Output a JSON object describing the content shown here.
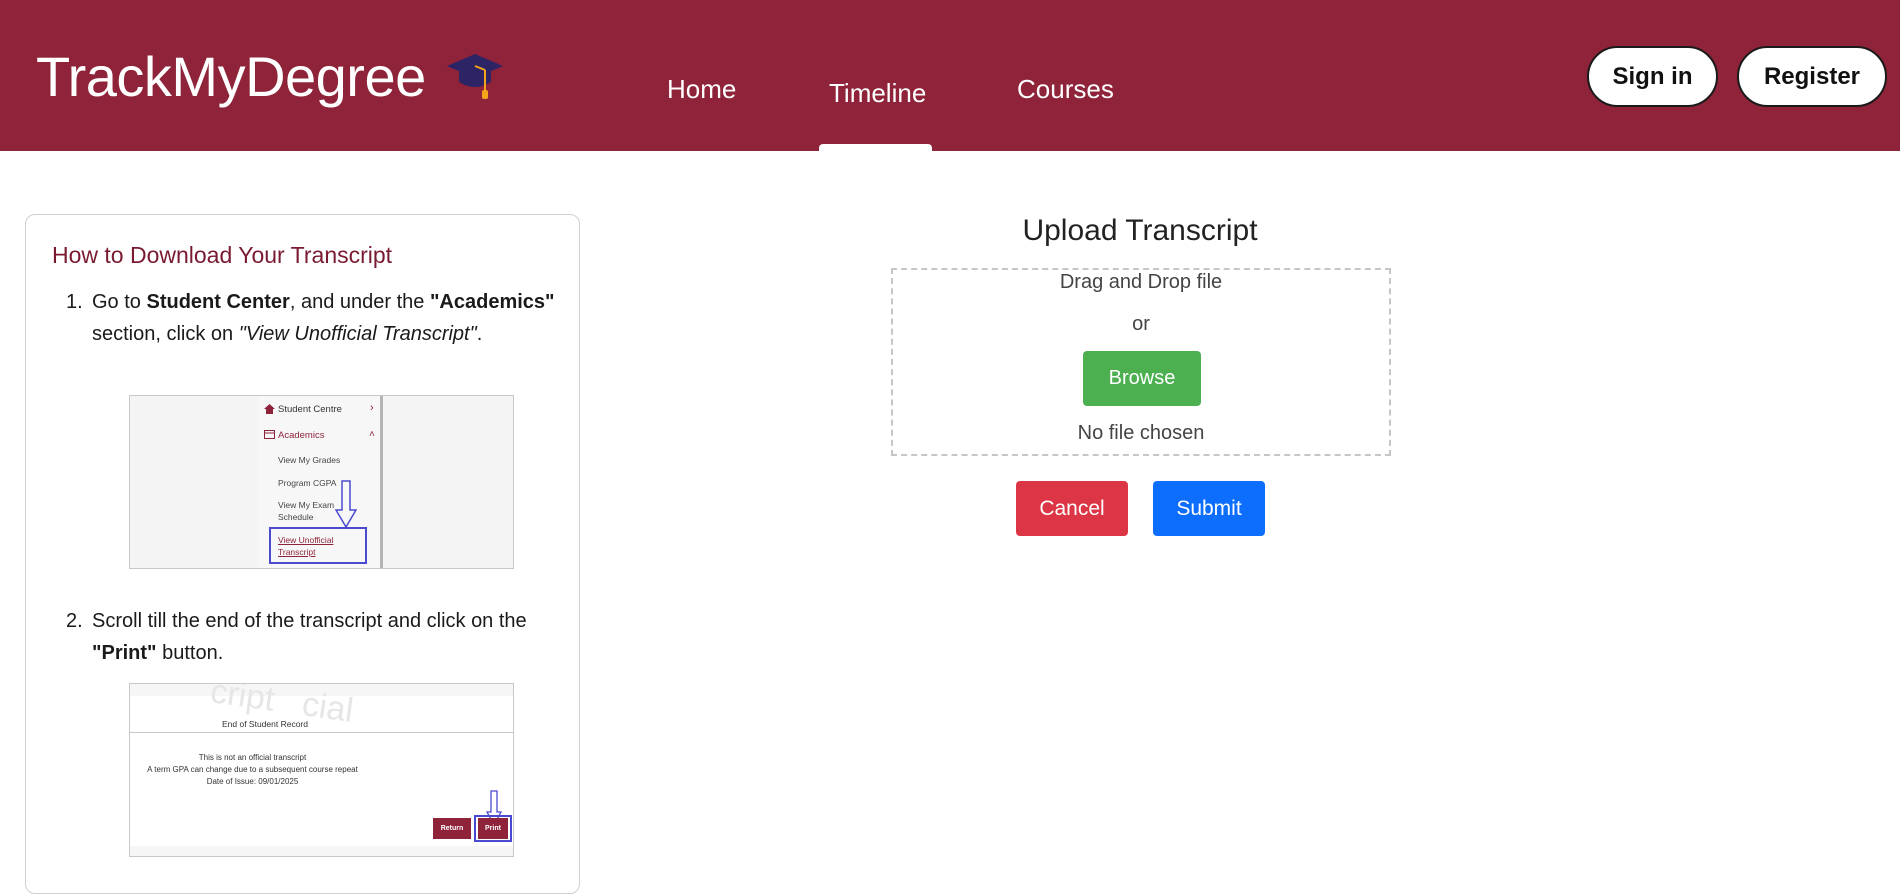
{
  "header": {
    "logo_text": "TrackMyDegree",
    "nav": [
      {
        "label": "Home"
      },
      {
        "label": "Timeline"
      },
      {
        "label": "Courses"
      }
    ],
    "active_nav": "Timeline",
    "sign_in_label": "Sign in",
    "register_label": "Register",
    "colors": {
      "brand": "#8e2339",
      "cap": "#2d2466",
      "tassel": "#f2a51a"
    }
  },
  "instructions": {
    "title": "How to Download Your Transcript",
    "step1": {
      "num": "1.",
      "t1": "Go to ",
      "b1": "Student Center",
      "t2": ", and under the ",
      "b2": "\"Academics\"",
      "t3": " section, click on ",
      "i1": "\"View Unofficial Transcript\"",
      "t4": "."
    },
    "shot1": {
      "student_centre": "Student Centre",
      "academics": "Academics",
      "items": [
        "View My Grades",
        "Program CGPA",
        "View My Exam",
        "Schedule"
      ],
      "link_line1": "View Unofficial",
      "link_line2": "Transcript"
    },
    "step2": {
      "num": "2.",
      "t1": "Scroll till the end of the transcript and click on the ",
      "b1": "\"Print\"",
      "t2": " button."
    },
    "shot2": {
      "watermark": "cript   cial",
      "end_record": "End of Student Record",
      "line1": "This is not an official transcript",
      "line2": "A term GPA can change due to a subsequent course repeat",
      "line3": "Date of Issue: 09/01/2025",
      "return_label": "Return",
      "print_label": "Print"
    }
  },
  "upload": {
    "title": "Upload Transcript",
    "drag_text": "Drag and Drop file",
    "or_text": "or",
    "browse_label": "Browse",
    "file_status": "No file chosen",
    "cancel_label": "Cancel",
    "submit_label": "Submit",
    "colors": {
      "browse": "#4caf50",
      "cancel": "#dc3545",
      "submit": "#0d6efd"
    }
  }
}
